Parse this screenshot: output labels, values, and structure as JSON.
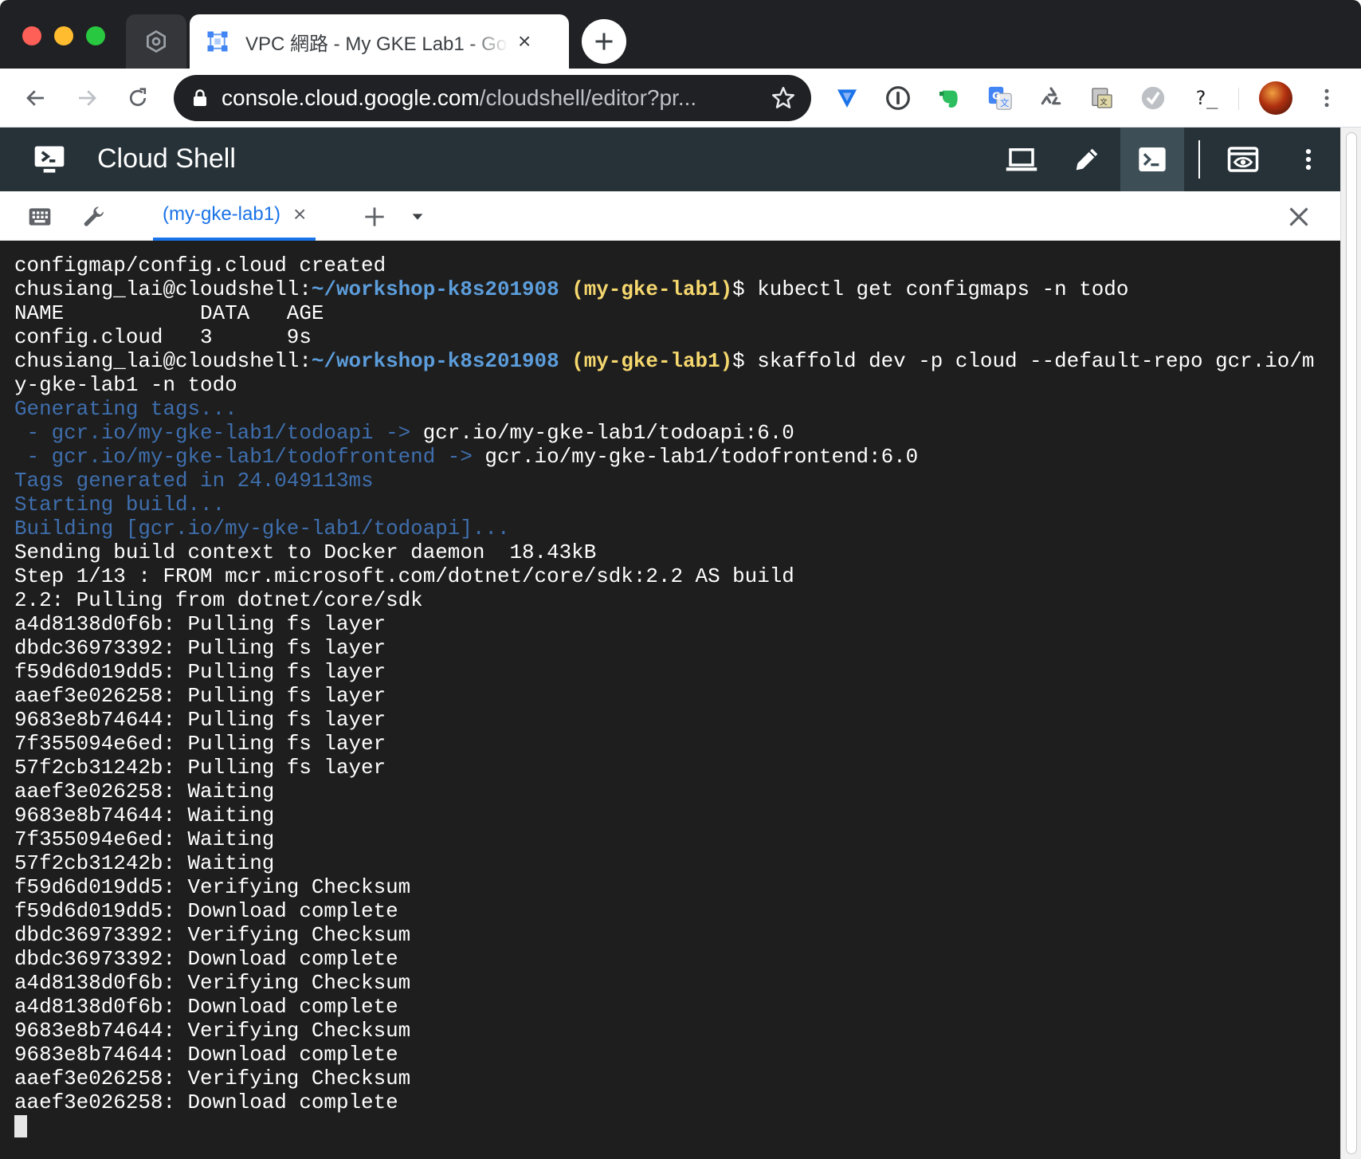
{
  "browser": {
    "tab": {
      "title": "VPC 網路 - My GKE Lab1 - Goo",
      "close": "×"
    },
    "newtab": "+",
    "omnibox": {
      "domain": "console.cloud.google.com",
      "path": "/cloudshell/editor?pr..."
    },
    "extensions": [
      "tunnel-icon",
      "1password-icon",
      "evernote-icon",
      "google-translate-icon",
      "recycle-icon",
      "dictionary-icon",
      "checkmark-circle-icon",
      "terminal-prompt-icon"
    ],
    "ext_terminal_label": "?_"
  },
  "cloudshell": {
    "title": "Cloud Shell",
    "toolbar": [
      "laptop-icon",
      "edit-pencil-icon",
      "terminal-icon",
      "web-preview-icon",
      "more-vert-icon"
    ],
    "terminal_tab": {
      "label": "(my-gke-lab1)",
      "close": "×"
    }
  },
  "terminal": {
    "user": "chusiang_lai@cloudshell:",
    "path": "~/workshop-k8s201908",
    "project": "(my-gke-lab1)",
    "lines": [
      {
        "text": "configmap/config.cloud created"
      },
      {
        "prompt": true,
        "cmd": "$ kubectl get configmaps -n todo"
      },
      {
        "text": "NAME           DATA   AGE"
      },
      {
        "text": "config.cloud   3      9s"
      },
      {
        "prompt": true,
        "cmd": "$ skaffold dev -p cloud --default-repo gcr.io/m"
      },
      {
        "text": "y-gke-lab1 -n todo"
      },
      {
        "dim": "Generating tags..."
      },
      {
        "dim": " - gcr.io/my-gke-lab1/todoapi -> ",
        "text": "gcr.io/my-gke-lab1/todoapi:6.0"
      },
      {
        "dim": " - gcr.io/my-gke-lab1/todofrontend -> ",
        "text": "gcr.io/my-gke-lab1/todofrontend:6.0"
      },
      {
        "dim": "Tags generated in 24.049113ms"
      },
      {
        "dim": "Starting build..."
      },
      {
        "dim": "Building [gcr.io/my-gke-lab1/todoapi]..."
      },
      {
        "text": "Sending build context to Docker daemon  18.43kB"
      },
      {
        "text": "Step 1/13 : FROM mcr.microsoft.com/dotnet/core/sdk:2.2 AS build"
      },
      {
        "text": "2.2: Pulling from dotnet/core/sdk"
      },
      {
        "text": "a4d8138d0f6b: Pulling fs layer"
      },
      {
        "text": "dbdc36973392: Pulling fs layer"
      },
      {
        "text": "f59d6d019dd5: Pulling fs layer"
      },
      {
        "text": "aaef3e026258: Pulling fs layer"
      },
      {
        "text": "9683e8b74644: Pulling fs layer"
      },
      {
        "text": "7f355094e6ed: Pulling fs layer"
      },
      {
        "text": "57f2cb31242b: Pulling fs layer"
      },
      {
        "text": "aaef3e026258: Waiting"
      },
      {
        "text": "9683e8b74644: Waiting"
      },
      {
        "text": "7f355094e6ed: Waiting"
      },
      {
        "text": "57f2cb31242b: Waiting"
      },
      {
        "text": "f59d6d019dd5: Verifying Checksum"
      },
      {
        "text": "f59d6d019dd5: Download complete"
      },
      {
        "text": "dbdc36973392: Verifying Checksum"
      },
      {
        "text": "dbdc36973392: Download complete"
      },
      {
        "text": "a4d8138d0f6b: Verifying Checksum"
      },
      {
        "text": "a4d8138d0f6b: Download complete"
      },
      {
        "text": "9683e8b74644: Verifying Checksum"
      },
      {
        "text": "9683e8b74644: Download complete"
      },
      {
        "text": "aaef3e026258: Verifying Checksum"
      },
      {
        "text": "aaef3e026258: Download complete"
      }
    ]
  },
  "colors": {
    "terminal_bg": "#1e1e1e",
    "prompt_path": "#5c9ddb",
    "prompt_project": "#f5d76e",
    "dim_output": "#3f6fae",
    "header_bg": "#263238",
    "accent": "#1a73e8"
  }
}
